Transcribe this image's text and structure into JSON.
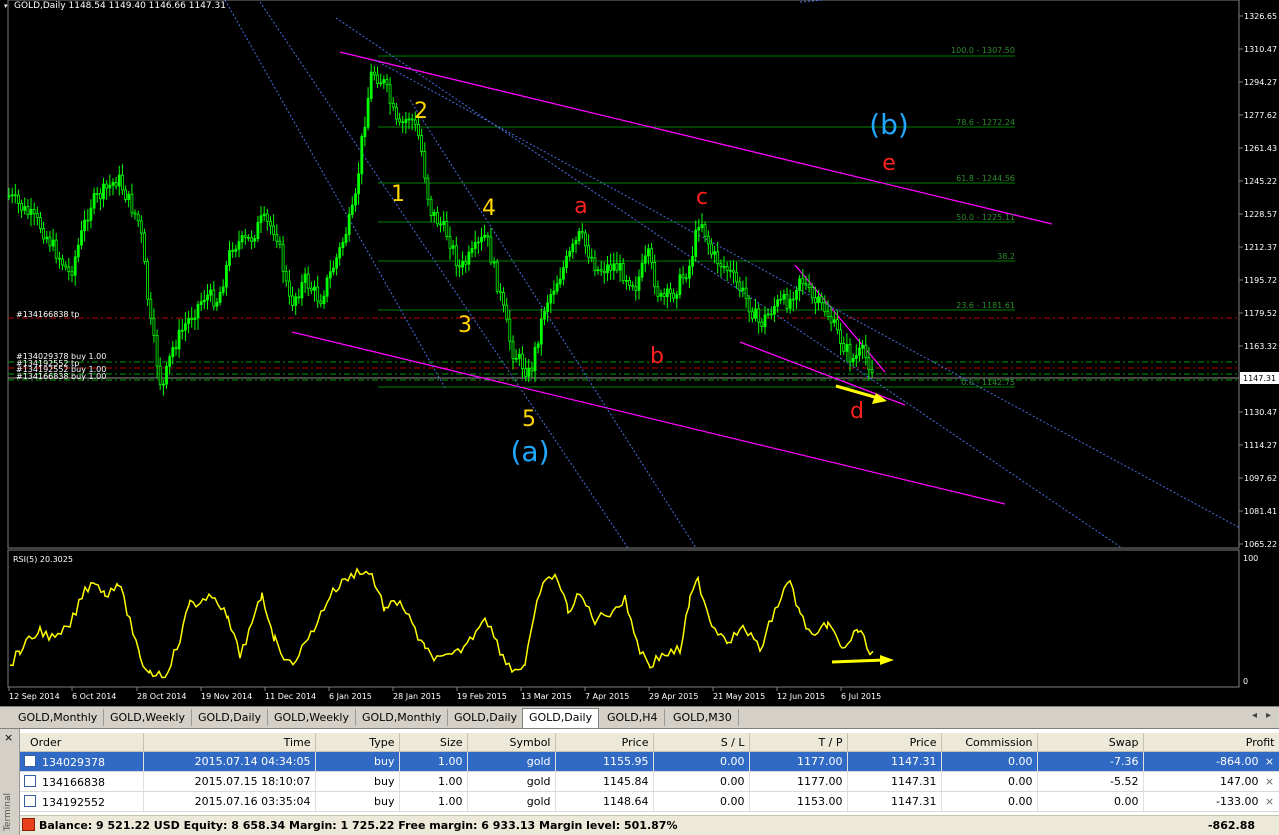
{
  "chart": {
    "header": "GOLD,Daily  1148.54 1149.40 1146.66 1147.31",
    "current_price": "1147.31",
    "price_labels": [
      "1326.65",
      "1310.47",
      "1294.27",
      "1277.62",
      "1261.43",
      "1245.22",
      "1228.57",
      "1212.37",
      "1195.72",
      "1179.52",
      "1163.32",
      "1147.31",
      "1130.47",
      "1114.27",
      "1097.62",
      "1081.41",
      "1065.22"
    ],
    "date_labels": [
      "12 Sep 2014",
      "6 Oct 2014",
      "28 Oct 2014",
      "19 Nov 2014",
      "11 Dec 2014",
      "6 Jan 2015",
      "28 Jan 2015",
      "19 Feb 2015",
      "13 Mar 2015",
      "7 Apr 2015",
      "29 Apr 2015",
      "21 May 2015",
      "12 Jun 2015",
      "6 Jul 2015"
    ],
    "fib_labels": [
      "100.0 - 1307.50",
      "78.6 - 1272.24",
      "61.8 - 1244.56",
      "50.0 - 1225.11",
      "38.2",
      "23.6 - 1181.61",
      "0.0 - 1142.75"
    ],
    "order_tags": [
      "#134166838 tp",
      "#134029378 buy 1.00",
      "#134192552 tp",
      "#134192552 buy 1.00",
      "#134166838 buy 1.00"
    ],
    "wave_labels": {
      "w1": "1",
      "w2": "2",
      "w3": "3",
      "w4": "4",
      "w5": "5",
      "wa": "a",
      "wb": "b",
      "wc": "c",
      "wd": "d",
      "we": "e",
      "big_a": "(a)",
      "big_b": "(b)"
    },
    "rsi_label": "RSI(5) 20.3025",
    "rsi_max": "100",
    "rsi_min": "0",
    "colors": {
      "candles": "#00ff00",
      "channel": "#ff00ff",
      "fib": "#008000",
      "trend": "#4a6ee0",
      "rsi": "#ffff00",
      "wave_yellow": "#ffd700",
      "wave_red": "#ff2020",
      "wave_blue": "#20a8ff"
    }
  },
  "tabs": {
    "items": [
      "GOLD,Monthly",
      "GOLD,Weekly",
      "GOLD,Daily",
      "GOLD,Weekly",
      "GOLD,Monthly",
      "GOLD,Daily",
      "GOLD,Daily",
      "GOLD,H4",
      "GOLD,M30"
    ],
    "active_index": 6
  },
  "terminal": {
    "side_label": "Terminal",
    "columns": [
      "Order",
      "Time",
      "Type",
      "Size",
      "Symbol",
      "Price",
      "S / L",
      "T / P",
      "Price",
      "Commission",
      "Swap",
      "Profit"
    ],
    "rows": [
      [
        "134029378",
        "2015.07.14 04:34:05",
        "buy",
        "1.00",
        "gold",
        "1155.95",
        "0.00",
        "1177.00",
        "1147.31",
        "0.00",
        "-7.36",
        "-864.00"
      ],
      [
        "134166838",
        "2015.07.15 18:10:07",
        "buy",
        "1.00",
        "gold",
        "1145.84",
        "0.00",
        "1177.00",
        "1147.31",
        "0.00",
        "-5.52",
        "147.00"
      ],
      [
        "134192552",
        "2015.07.16 03:35:04",
        "buy",
        "1.00",
        "gold",
        "1148.64",
        "0.00",
        "1153.00",
        "1147.31",
        "0.00",
        "0.00",
        "-133.00"
      ]
    ],
    "selected_row": 0,
    "balance_text": "Balance: 9 521.22 USD  Equity: 8 658.34  Margin: 1 725.22  Free margin: 6 933.13  Margin level: 501.87%",
    "total_profit": "-862.88"
  }
}
